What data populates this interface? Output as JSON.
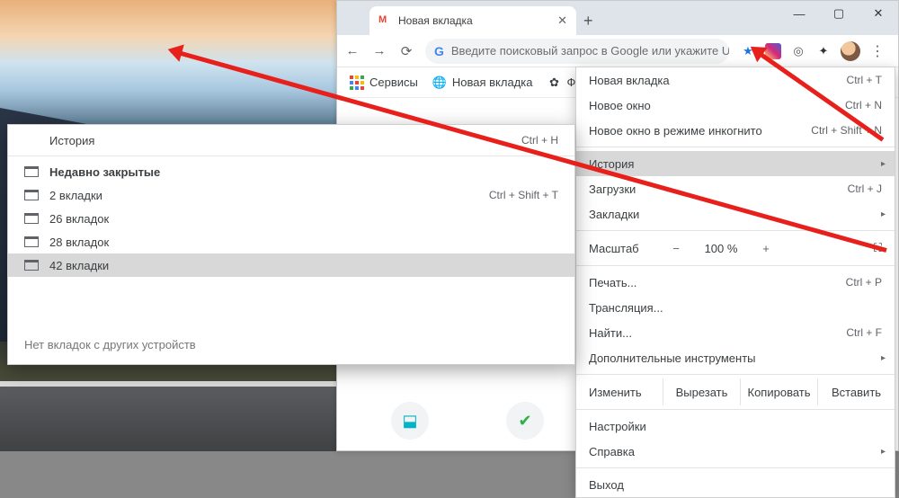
{
  "window": {
    "min": "—",
    "max": "▢",
    "close": "✕"
  },
  "tab": {
    "title": "Новая вкладка",
    "close": "✕",
    "new": "+"
  },
  "addr": {
    "back": "←",
    "fwd": "→",
    "reload": "⟳",
    "placeholder": "Введите поисковый запрос в Google или укажите U...",
    "star": "★",
    "dots": "⋮"
  },
  "bookmarks": {
    "apps": "Сервисы",
    "newtab": "Новая вкладка",
    "films": "Фильм..."
  },
  "menu": {
    "newTab": {
      "label": "Новая вкладка",
      "key": "Ctrl + T"
    },
    "newWin": {
      "label": "Новое окно",
      "key": "Ctrl + N"
    },
    "incog": {
      "label": "Новое окно в режиме инкогнито",
      "key": "Ctrl + Shift + N"
    },
    "history": {
      "label": "История"
    },
    "downloads": {
      "label": "Загрузки",
      "key": "Ctrl + J"
    },
    "bookmarks": {
      "label": "Закладки"
    },
    "zoom": {
      "label": "Масштаб",
      "minus": "−",
      "pct": "100 %",
      "plus": "+",
      "full": "⛶"
    },
    "print": {
      "label": "Печать...",
      "key": "Ctrl + P"
    },
    "cast": {
      "label": "Трансляция..."
    },
    "find": {
      "label": "Найти...",
      "key": "Ctrl + F"
    },
    "tools": {
      "label": "Дополнительные инструменты"
    },
    "edit": {
      "label": "Изменить",
      "cut": "Вырезать",
      "copy": "Копировать",
      "paste": "Вставить"
    },
    "settings": {
      "label": "Настройки"
    },
    "help": {
      "label": "Справка"
    },
    "exit": {
      "label": "Выход"
    }
  },
  "submenu": {
    "history": {
      "label": "История",
      "key": "Ctrl + H"
    },
    "recent": "Недавно закрытые",
    "items": [
      {
        "label": "2 вкладки",
        "key": "Ctrl + Shift + T"
      },
      {
        "label": "26 вкладок",
        "key": ""
      },
      {
        "label": "28 вкладок",
        "key": ""
      },
      {
        "label": "42 вкладки",
        "key": ""
      }
    ],
    "footer": "Нет вкладок с других устройств"
  }
}
